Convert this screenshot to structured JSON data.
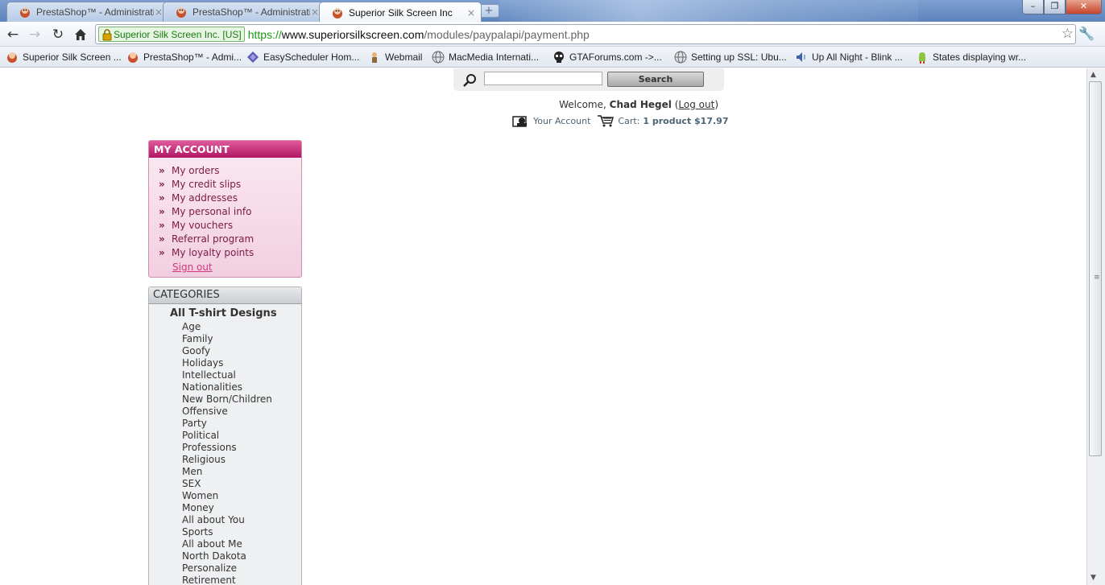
{
  "browser": {
    "tabs": [
      {
        "title": "PrestaShop™ - Administrati",
        "active": false
      },
      {
        "title": "PrestaShop™ - Administrati",
        "active": false
      },
      {
        "title": "Superior Silk Screen Inc",
        "active": true
      }
    ],
    "tab_close": "×",
    "new_tab": "+",
    "ssl_label": "Superior Silk Screen Inc. [US]",
    "url_scheme": "https://",
    "url_host": "www.superiorsilkscreen.com",
    "url_path": "/modules/paypalapi/payment.php",
    "bookmarks": [
      {
        "label": "Superior Silk Screen ...",
        "icon": "prestashop-icon"
      },
      {
        "label": "PrestaShop™ - Admi...",
        "icon": "prestashop-icon"
      },
      {
        "label": "EasyScheduler Hom...",
        "icon": "diamond-icon"
      },
      {
        "label": "Webmail",
        "icon": "webmail-icon"
      },
      {
        "label": "MacMedia Internati...",
        "icon": "globe-icon"
      },
      {
        "label": "GTAForums.com ->...",
        "icon": "skull-icon"
      },
      {
        "label": "Setting up SSL: Ubu...",
        "icon": "globe-icon"
      },
      {
        "label": "Up All Night - Blink ...",
        "icon": "speaker-icon"
      },
      {
        "label": "States displaying wr...",
        "icon": "android-icon"
      }
    ]
  },
  "header": {
    "search_placeholder": "",
    "search_button": "Search",
    "welcome_prefix": "Welcome,",
    "user_name": "Chad Hegel",
    "logout": "Log out",
    "your_account": "Your Account",
    "cart_label": "Cart:",
    "cart_summary": "1 product $17.97"
  },
  "my_account": {
    "title": "MY ACCOUNT",
    "items": [
      "My orders",
      "My credit slips",
      "My addresses",
      "My personal info",
      "My vouchers",
      "Referral program",
      "My loyalty points"
    ],
    "sign_out": "Sign out"
  },
  "categories": {
    "title": "CATEGORIES",
    "top_level": "All T-shirt Designs",
    "items": [
      "Age",
      "Family",
      "Goofy",
      "Holidays",
      "Intellectual",
      "Nationalities",
      "New Born/Children",
      "Offensive",
      "Party",
      "Political",
      "Professions",
      "Religious",
      "Men",
      "SEX",
      "Women",
      "Money",
      "All about You",
      "Sports",
      "All about Me",
      "North Dakota",
      "Personalize",
      "Retirement"
    ]
  },
  "colors": {
    "account_header": "#b01763",
    "account_link": "#7a1a45",
    "signout_link": "#d0367d",
    "ssl_green": "#1b7b12"
  }
}
